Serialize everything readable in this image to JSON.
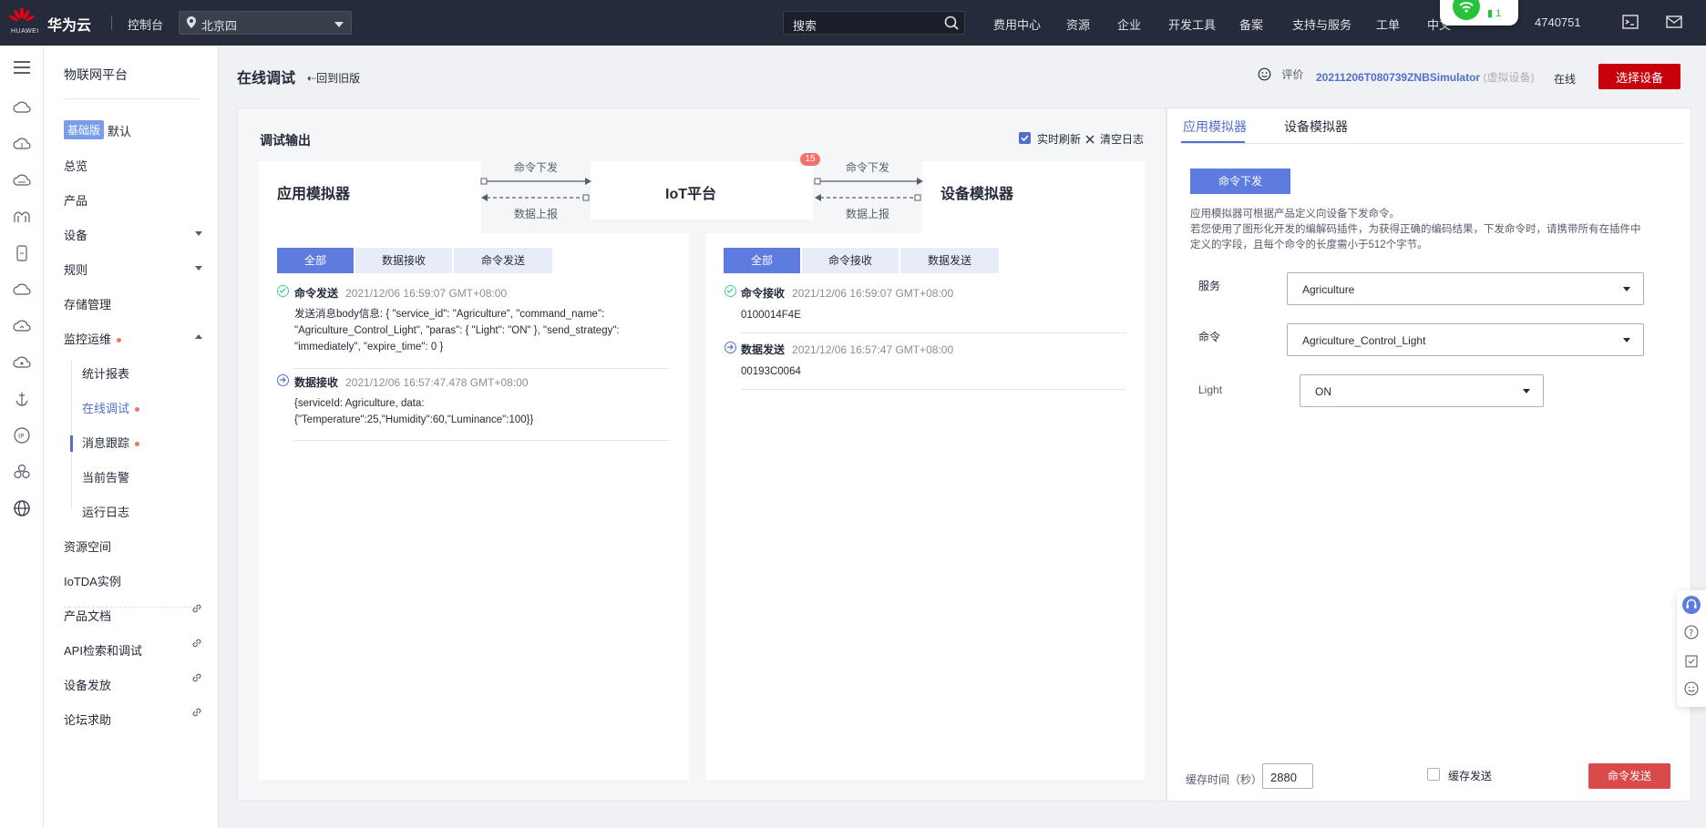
{
  "topbar": {
    "logo_text": "HUAWEI",
    "brand": "华为云",
    "console": "控制台",
    "region": "北京四",
    "search_placeholder": "搜索",
    "nav": [
      "费用中心",
      "资源",
      "企业",
      "开发工具",
      "备案",
      "支持与服务",
      "工单",
      "中文",
      "4740751"
    ],
    "battery_level": "1"
  },
  "sidebar": {
    "title": "物联网平台",
    "edition_badge": "基础版",
    "edition_value": "默认",
    "items": [
      {
        "label": "总览"
      },
      {
        "label": "产品"
      },
      {
        "label": "设备"
      },
      {
        "label": "规则"
      },
      {
        "label": "存储管理"
      },
      {
        "label": "监控运维"
      },
      {
        "label": "资源空间"
      },
      {
        "label": "IoTDA实例"
      },
      {
        "label": "产品文档"
      },
      {
        "label": "API检索和调试"
      },
      {
        "label": "设备发放"
      },
      {
        "label": "论坛求助"
      }
    ],
    "sub_items": [
      {
        "label": "统计报表"
      },
      {
        "label": "在线调试"
      },
      {
        "label": "消息跟踪"
      },
      {
        "label": "当前告警"
      },
      {
        "label": "运行日志"
      }
    ]
  },
  "header": {
    "title": "在线调试",
    "back_link": "回到旧版",
    "rate_label": "评价",
    "device_name": "20211206T080739ZNBSimulator",
    "device_type": "(虚拟设备)",
    "status": "在线",
    "select_device": "选择设备"
  },
  "debug": {
    "title": "调试输出",
    "realtime_refresh": "实时刷新",
    "clear_log": "清空日志",
    "app_sim": "应用模拟器",
    "platform": "IoT平台",
    "device_sim": "设备模拟器",
    "cmd_down": "命令下发",
    "data_up": "数据上报",
    "badge_count": "15",
    "left_tabs": [
      "全部",
      "数据接收",
      "命令发送"
    ],
    "right_tabs": [
      "全部",
      "命令接收",
      "数据发送"
    ],
    "left_logs": [
      {
        "type": "命令发送",
        "time": "2021/12/06 16:59:07 GMT+08:00",
        "body": [
          "发送消息body信息: { \"service_id\": \"Agriculture\", \"command_name\":",
          "\"Agriculture_Control_Light\", \"paras\": { \"Light\": \"ON\" }, \"send_strategy\":",
          "\"immediately\", \"expire_time\": 0 }"
        ]
      },
      {
        "type": "数据接收",
        "time": "2021/12/06 16:57:47.478 GMT+08:00",
        "body": [
          "{serviceId: Agriculture, data:",
          "{\"Temperature\":25,\"Humidity\":60,\"Luminance\":100}}"
        ]
      }
    ],
    "right_logs": [
      {
        "type": "命令接收",
        "time": "2021/12/06 16:59:07 GMT+08:00",
        "body": [
          "0100014F4E"
        ]
      },
      {
        "type": "数据发送",
        "time": "2021/12/06 16:57:47 GMT+08:00",
        "body": [
          "00193C0064"
        ]
      }
    ]
  },
  "simulator": {
    "tabs": [
      "应用模拟器",
      "设备模拟器"
    ],
    "cmd_button": "命令下发",
    "desc_lines": [
      "应用模拟器可根据产品定义向设备下发命令。",
      "若您使用了图形化开发的编解码插件，为获得正确的编码结果，下发命令时，请携带所有在插件中",
      "定义的字段，且每个命令的长度需小于512个字节。"
    ],
    "service_label": "服务",
    "service_value": "Agriculture",
    "command_label": "命令",
    "command_value": "Agriculture_Control_Light",
    "light_label": "Light",
    "light_value": "ON",
    "cache_time_label": "缓存时间（秒）",
    "cache_time_value": "2880",
    "cache_send_label": "缓存发送",
    "send_button": "命令发送"
  },
  "colors": {
    "topbar_bg": "#252b3a",
    "accent": "#526ecc",
    "primary_red": "#c7000b",
    "tab_active": "#5e7ce0",
    "success": "#3dcca6"
  }
}
